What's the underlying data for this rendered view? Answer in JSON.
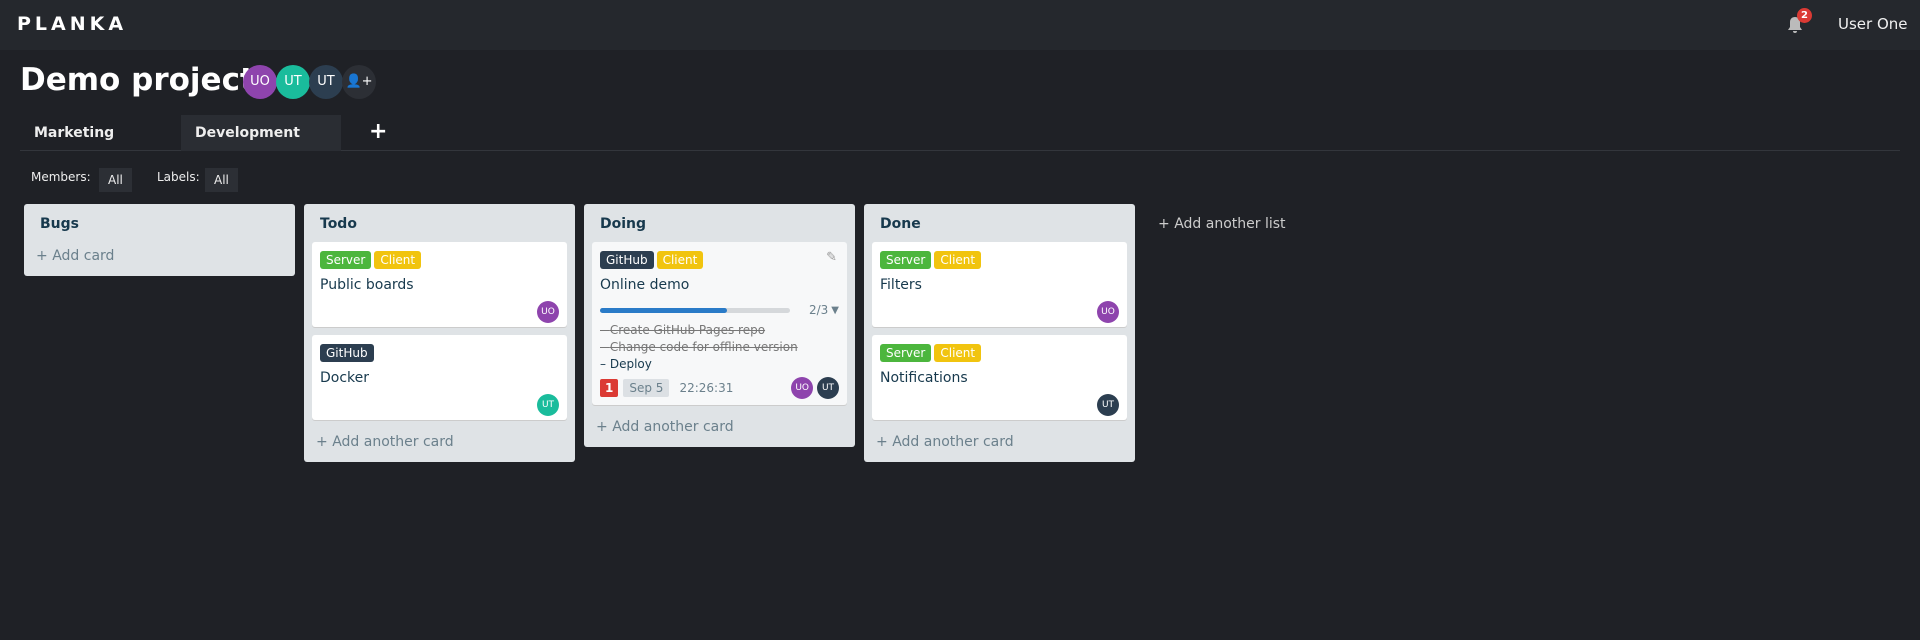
{
  "header": {
    "logo": "PLANKA",
    "notifications": "2",
    "user": "User One"
  },
  "project": {
    "title": "Demo project",
    "members": [
      {
        "initials": "UO",
        "color": "#8e44ad"
      },
      {
        "initials": "UT",
        "color": "#1abc9c"
      },
      {
        "initials": "UT",
        "color": "#2c3e50"
      }
    ]
  },
  "tabs": [
    {
      "label": "Marketing"
    },
    {
      "label": "Development"
    }
  ],
  "filters": {
    "members_label": "Members:",
    "members_value": "All",
    "labels_label": "Labels:",
    "labels_value": "All"
  },
  "lists": [
    {
      "title": "Bugs",
      "add": "Add card"
    },
    {
      "title": "Todo",
      "add": "Add another card",
      "cards": [
        {
          "labels": [
            {
              "text": "Server",
              "color": "#4cb63d"
            },
            {
              "text": "Client",
              "color": "#f1c40f"
            }
          ],
          "title": "Public boards",
          "members": [
            "UO"
          ]
        },
        {
          "labels": [
            {
              "text": "GitHub",
              "color": "#2c3e50"
            }
          ],
          "title": "Docker",
          "members": [
            "UT"
          ]
        }
      ]
    },
    {
      "title": "Doing",
      "add": "Add another card",
      "cards": [
        {
          "labels": [
            {
              "text": "GitHub",
              "color": "#2c3e50"
            },
            {
              "text": "Client",
              "color": "#f1c40f"
            }
          ],
          "title": "Online demo",
          "progress": "2/3",
          "progress_fraction": 0.667,
          "tasks": [
            {
              "text": "Create GitHub Pages repo",
              "done": true
            },
            {
              "text": "Change code for offline version",
              "done": true
            },
            {
              "text": "Deploy",
              "done": false
            }
          ],
          "count": "1",
          "due": "Sep 5",
          "timer": "22:26:31",
          "members": [
            "UO",
            "UT"
          ]
        }
      ]
    },
    {
      "title": "Done",
      "add": "Add another card",
      "cards": [
        {
          "labels": [
            {
              "text": "Server",
              "color": "#4cb63d"
            },
            {
              "text": "Client",
              "color": "#f1c40f"
            }
          ],
          "title": "Filters",
          "members": [
            "UO"
          ]
        },
        {
          "labels": [
            {
              "text": "Server",
              "color": "#4cb63d"
            },
            {
              "text": "Client",
              "color": "#f1c40f"
            }
          ],
          "title": "Notifications",
          "members": [
            "UT"
          ]
        }
      ]
    }
  ],
  "add_list": "Add another list"
}
